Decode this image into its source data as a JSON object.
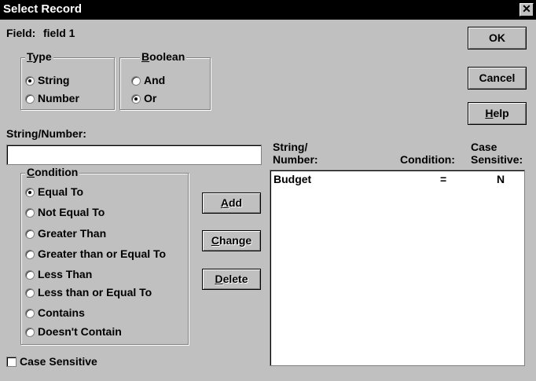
{
  "window": {
    "title": "Select Record",
    "close_glyph": "✕",
    "close_icon": "close-icon"
  },
  "field": {
    "label": "Field:",
    "value": "field 1"
  },
  "type_group": {
    "legend_u": "T",
    "legend_rest": "ype",
    "options": [
      {
        "label": "String",
        "selected": true
      },
      {
        "label": "Number",
        "selected": false
      }
    ]
  },
  "boolean_group": {
    "legend_u": "B",
    "legend_rest": "oolean",
    "options": [
      {
        "label": "And",
        "selected": false
      },
      {
        "label": "Or",
        "selected": true
      }
    ]
  },
  "string_number": {
    "label": "String/Number:",
    "value": ""
  },
  "condition_group": {
    "legend_u": "C",
    "legend_rest": "ondition",
    "options": [
      {
        "label": "Equal To",
        "selected": true
      },
      {
        "label": "Not Equal To",
        "selected": false
      },
      {
        "label": "Greater Than",
        "selected": false
      },
      {
        "label": "Greater than or Equal To",
        "selected": false
      },
      {
        "label": "Less Than",
        "selected": false
      },
      {
        "label": "Less than or Equal To",
        "selected": false
      },
      {
        "label": "Contains",
        "selected": false
      },
      {
        "label": "Doesn't Contain",
        "selected": false
      }
    ]
  },
  "case_sensitive": {
    "label": "Case Sensitive",
    "checked": false
  },
  "buttons": {
    "ok": "OK",
    "cancel": "Cancel",
    "help_u": "H",
    "help_rest": "elp",
    "add_u": "A",
    "add_rest": "dd",
    "change_u": "C",
    "change_rest": "hange",
    "delete_u": "D",
    "delete_rest": "elete"
  },
  "list": {
    "headers": {
      "string_line1": "String/",
      "string_line2": "Number:",
      "condition": "Condition:",
      "case_line1": "Case",
      "case_line2": "Sensitive:"
    },
    "rows": [
      {
        "string": "Budget",
        "condition": "=",
        "case": "N"
      }
    ]
  }
}
